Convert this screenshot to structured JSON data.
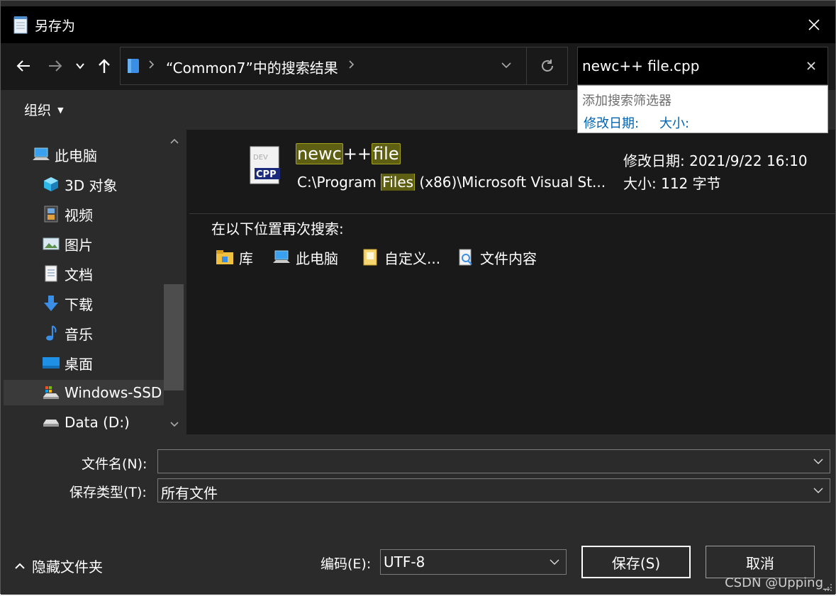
{
  "title": {
    "text": "另存为"
  },
  "address": {
    "text": "“Common7”中的搜索结果"
  },
  "search": {
    "value": "newc++ file.cpp"
  },
  "suggest": {
    "title": "添加搜索筛选器",
    "option1": "修改日期:",
    "option2": "大小:"
  },
  "toolbar": {
    "organize": "组织"
  },
  "nav": {
    "items": [
      {
        "label": "此电脑"
      },
      {
        "label": "3D 对象"
      },
      {
        "label": "视频"
      },
      {
        "label": "图片"
      },
      {
        "label": "文档"
      },
      {
        "label": "下载"
      },
      {
        "label": "音乐"
      },
      {
        "label": "桌面"
      },
      {
        "label": "Windows-SSD"
      },
      {
        "label": "Data (D:)"
      }
    ]
  },
  "result": {
    "name_hl1": "newc",
    "name_mid": "++",
    "name_hl2": "file",
    "path_pre": "C:\\Program ",
    "path_hl": "Files",
    "path_post": " (x86)\\Microsoft Visual St...",
    "modified": "修改日期: 2021/9/22 16:10",
    "size": "大小: 112 字节",
    "icon_label": "CPP"
  },
  "search_again": {
    "title": "在以下位置再次搜索:",
    "locations": [
      {
        "label": "库"
      },
      {
        "label": "此电脑"
      },
      {
        "label": "自定义..."
      },
      {
        "label": "文件内容"
      }
    ]
  },
  "bottom": {
    "filename_label": "文件名(N):",
    "filename_value": "",
    "filetype_label": "保存类型(T):",
    "filetype_value": "所有文件",
    "hide_folders": "隐藏文件夹",
    "encoding_label": "编码(E):",
    "encoding_value": "UTF-8",
    "save_label": "保存(S)",
    "cancel_label": "取消"
  },
  "watermark": {
    "text": "CSDN @Upping_"
  },
  "colors": {
    "highlight_bg": "#5e5f12",
    "highlight_border": "#a2a31d",
    "link_blue": "#0063b1"
  }
}
